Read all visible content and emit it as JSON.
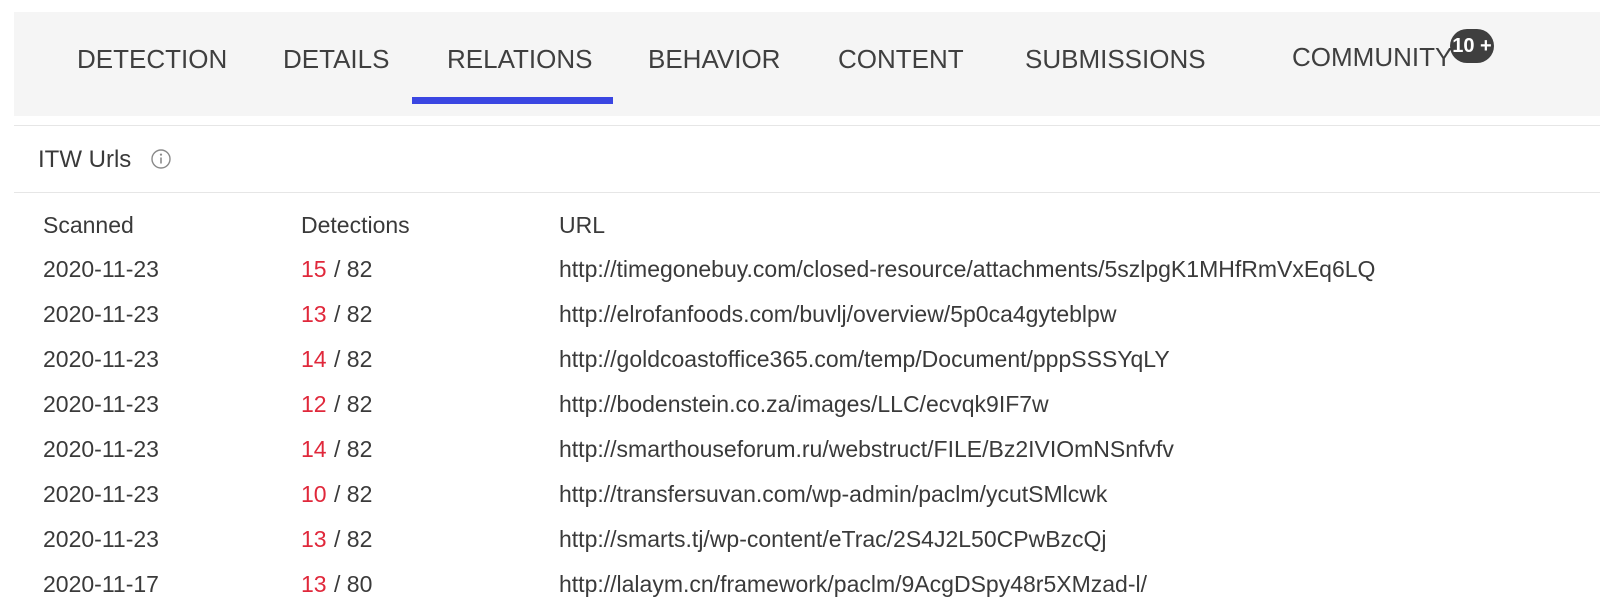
{
  "tabs": [
    {
      "label": "DETECTION"
    },
    {
      "label": "DETAILS"
    },
    {
      "label": "RELATIONS"
    },
    {
      "label": "BEHAVIOR"
    },
    {
      "label": "CONTENT"
    },
    {
      "label": "SUBMISSIONS"
    },
    {
      "label": "COMMUNITY",
      "badge": "10 +"
    }
  ],
  "active_tab": "RELATIONS",
  "colors": {
    "accent": "#3a46e2",
    "detection_positive": "#e0283b",
    "badge_bg": "#3f3f3f"
  },
  "section": {
    "title": "ITW Urls",
    "info_icon": "info-circle-icon"
  },
  "table": {
    "headers": {
      "scanned": "Scanned",
      "detections": "Detections",
      "url": "URL"
    },
    "rows": [
      {
        "scanned": "2020-11-23",
        "positives": "15",
        "total": "/ 82",
        "url": "http://timegonebuy.com/closed-resource/attachments/5szlpgK1MHfRmVxEq6LQ"
      },
      {
        "scanned": "2020-11-23",
        "positives": "13",
        "total": "/ 82",
        "url": "http://elrofanfoods.com/buvlj/overview/5p0ca4gyteblpw"
      },
      {
        "scanned": "2020-11-23",
        "positives": "14",
        "total": "/ 82",
        "url": "http://goldcoastoffice365.com/temp/Document/pppSSSYqLY"
      },
      {
        "scanned": "2020-11-23",
        "positives": "12",
        "total": "/ 82",
        "url": "http://bodenstein.co.za/images/LLC/ecvqk9IF7w"
      },
      {
        "scanned": "2020-11-23",
        "positives": "14",
        "total": "/ 82",
        "url": "http://smarthouseforum.ru/webstruct/FILE/Bz2IVIOmNSnfvfv"
      },
      {
        "scanned": "2020-11-23",
        "positives": "10",
        "total": "/ 82",
        "url": "http://transfersuvan.com/wp-admin/paclm/ycutSMlcwk"
      },
      {
        "scanned": "2020-11-23",
        "positives": "13",
        "total": "/ 82",
        "url": "http://smarts.tj/wp-content/eTrac/2S4J2L50CPwBzcQj"
      },
      {
        "scanned": "2020-11-17",
        "positives": "13",
        "total": "/ 80",
        "url": "http://lalaym.cn/framework/paclm/9AcgDSpy48r5XMzad-l/"
      }
    ]
  }
}
